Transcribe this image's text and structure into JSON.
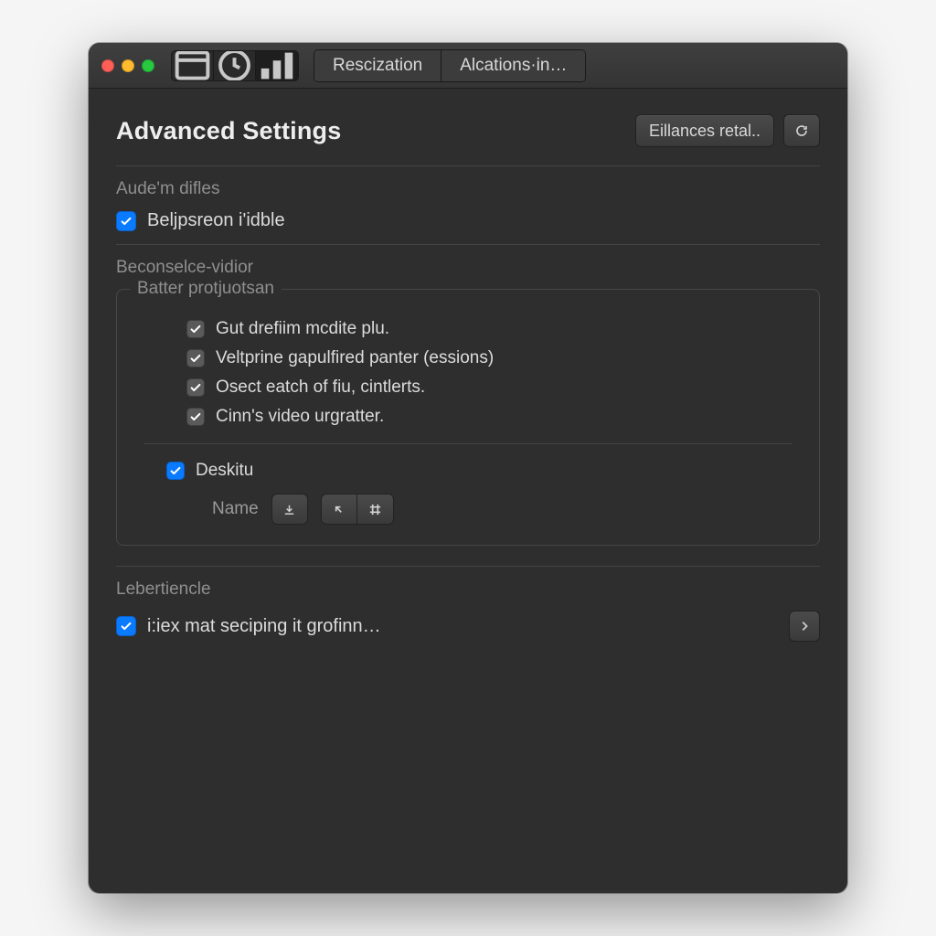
{
  "toolbar": {
    "tabs": [
      {
        "label": "Rescization"
      },
      {
        "label": "Alcations·in…"
      }
    ]
  },
  "header": {
    "title": "Advanced Settings",
    "action_btn": "Eillances retal..",
    "refresh_icon": "refresh-icon"
  },
  "section1": {
    "label": "Aude'm difles",
    "item1": "Beljpsreon i'idble"
  },
  "section2": {
    "label": "Beconselce-vidior",
    "fieldset_legend": "Batter protjuotsan",
    "opts": [
      "Gut drefiim mcdite plu.",
      "Veltprine gapulfired panter (essions)",
      "Osect eatch of fiu, cintlerts.",
      "Cinn's video urgratter."
    ],
    "deskitu": "Deskitu",
    "name_label": "Name"
  },
  "section3": {
    "label": "Lebertiencle",
    "item1": "i:iex mat seciping it grofinn…"
  }
}
